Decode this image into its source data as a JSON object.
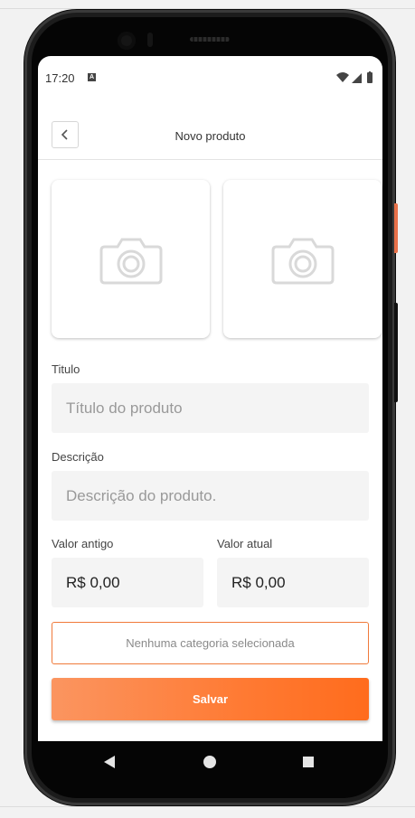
{
  "status_bar": {
    "time": "17:20",
    "notification_icon": "text-a-icon",
    "icons": [
      "wifi-icon",
      "signal-icon",
      "battery-icon"
    ]
  },
  "header": {
    "title": "Novo produto",
    "back_icon": "chevron-left-icon"
  },
  "photos": [
    {
      "icon": "camera-icon"
    },
    {
      "icon": "camera-icon"
    }
  ],
  "form": {
    "title_label": "Titulo",
    "title_placeholder": "Título do produto",
    "description_label": "Descrição",
    "description_placeholder": "Descrição do produto.",
    "old_price_label": "Valor antigo",
    "old_price_value": "R$ 0,00",
    "current_price_label": "Valor atual",
    "current_price_value": "R$ 0,00",
    "category_text": "Nenhuma categoria selecionada",
    "save_label": "Salvar"
  },
  "nav_bar": {
    "icons": [
      "back-triangle-icon",
      "home-circle-icon",
      "recents-square-icon"
    ]
  },
  "colors": {
    "accent": "#ff7a33",
    "accent_light": "#fb9560",
    "input_background": "#f4f4f4",
    "placeholder_text": "#999999"
  }
}
